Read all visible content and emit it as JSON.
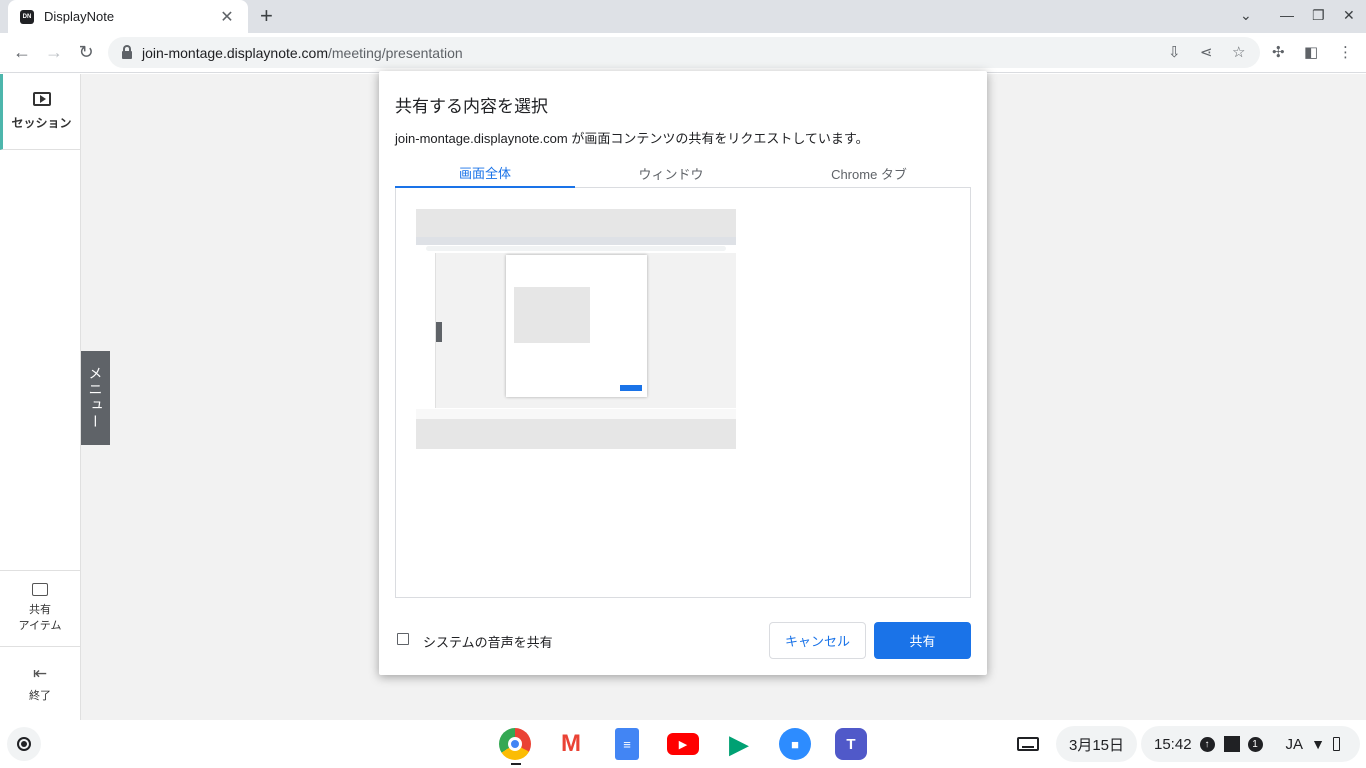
{
  "browser": {
    "tab_title": "DisplayNote",
    "tab_favicon_text": "DN",
    "url_host": "join-montage.displaynote.com",
    "url_path": "/meeting/presentation"
  },
  "sidebar": {
    "session_label": "セッション",
    "shared_label_line1": "共有",
    "shared_label_line2": "アイテム",
    "exit_label": "終了"
  },
  "menu_handle_label": "メニュー",
  "dialog": {
    "title": "共有する内容を選択",
    "subtitle": "join-montage.displaynote.com が画面コンテンツの共有をリクエストしています。",
    "tabs": [
      {
        "label": "画面全体",
        "active": true
      },
      {
        "label": "ウィンドウ",
        "active": false
      },
      {
        "label": "Chrome タブ",
        "active": false
      }
    ],
    "audio_checkbox_label": "システムの音声を共有",
    "audio_checked": false,
    "cancel_label": "キャンセル",
    "share_label": "共有"
  },
  "shelf": {
    "apps": [
      "chrome-icon",
      "gmail-icon",
      "docs-icon",
      "youtube-icon",
      "play-store-icon",
      "zoom-icon",
      "teams-icon"
    ],
    "date": "3月15日",
    "time": "15:42",
    "notification_count": "1",
    "ime": "JA"
  },
  "colors": {
    "accent": "#1a73e8",
    "session_indicator": "#4db6ac",
    "menu_handle": "#5f6368"
  }
}
